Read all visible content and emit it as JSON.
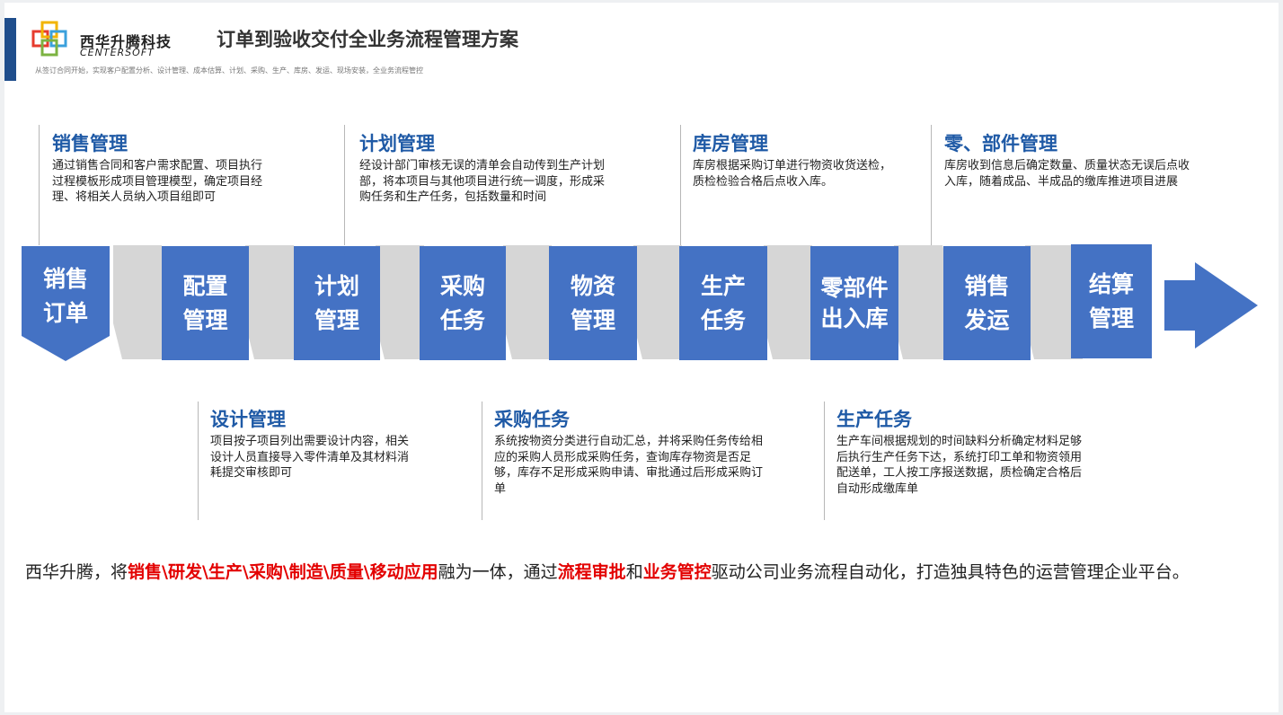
{
  "header": {
    "company_cn": "西华升腾科技",
    "company_en": "CENTERSOFT",
    "title": "订单到验收交付全业务流程管理方案",
    "subtitle": "从签订合同开始，实现客户配置分析、设计管理、成本估算、计划、采购、生产、库房、发运、现场安装，全业务流程管控",
    "accent_color": "#1f4e8c",
    "logo_icon": "centersoft-logo"
  },
  "top_notes": [
    {
      "title": "销售管理",
      "text": "通过销售合同和客户需求配置、项目执行过程模板形成项目管理模型，确定项目经理、将相关人员纳入项目组即可"
    },
    {
      "title": "计划管理",
      "text": "经设计部门审核无误的清单会自动传到生产计划部，将本项目与其他项目进行统一调度，形成采购任务和生产任务，包括数量和时间"
    },
    {
      "title": "库房管理",
      "text": "库房根据采购订单进行物资收货送检，质检检验合格后点收入库。"
    },
    {
      "title": "零、部件管理",
      "text": "库房收到信息后确定数量、质量状态无误后点收入库，随着成品、半成品的缴库推进项目进展"
    }
  ],
  "steps": [
    {
      "line1": "销售",
      "line2": "订单"
    },
    {
      "line1": "配置",
      "line2": "管理"
    },
    {
      "line1": "计划",
      "line2": "管理"
    },
    {
      "line1": "采购",
      "line2": "任务"
    },
    {
      "line1": "物资",
      "line2": "管理"
    },
    {
      "line1": "生产",
      "line2": "任务"
    },
    {
      "line1": "零部件",
      "line2": "出入库"
    },
    {
      "line1": "销售",
      "line2": "发运"
    },
    {
      "line1": "结算",
      "line2": "管理"
    }
  ],
  "step_color": "#4472c4",
  "connector_color": "#d6d6d6",
  "bottom_notes": [
    {
      "title": "设计管理",
      "text": "项目按子项目列出需要设计内容，相关设计人员直接导入零件清单及其材料消耗提交审核即可"
    },
    {
      "title": "采购任务",
      "text": "系统按物资分类进行自动汇总，并将采购任务传给相应的采购人员形成采购任务，查询库存物资是否足够，库存不足形成采购申请、审批通过后形成采购订单"
    },
    {
      "title": "生产任务",
      "text": "生产车间根据规划的时间缺料分析确定材料足够后执行生产任务下达，系统打印工单和物资领用配送单，工人按工序报送数据，质检确定合格后自动形成缴库单"
    }
  ],
  "summary": {
    "part1": "西华升腾，将",
    "highlight1": "销售\\研发\\生产\\采购\\制造\\质量\\移动应用",
    "part2": "融为一体，通过",
    "highlight2": "流程审批",
    "part3": "和",
    "highlight3": "业务管控",
    "part4": "驱动公司业务流程自动化，打造独具特色的运营管理企业平台。",
    "highlight_color": "#e30000"
  }
}
